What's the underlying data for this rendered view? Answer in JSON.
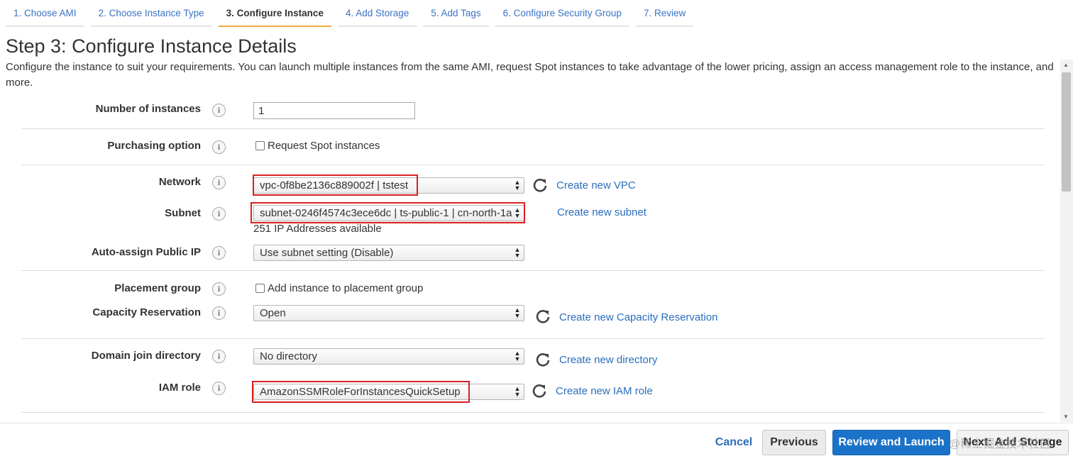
{
  "tabs": [
    {
      "label": "1. Choose AMI"
    },
    {
      "label": "2. Choose Instance Type"
    },
    {
      "label": "3. Configure Instance"
    },
    {
      "label": "4. Add Storage"
    },
    {
      "label": "5. Add Tags"
    },
    {
      "label": "6. Configure Security Group"
    },
    {
      "label": "7. Review"
    }
  ],
  "active_tab_index": 2,
  "page": {
    "title": "Step 3: Configure Instance Details",
    "description": "Configure the instance to suit your requirements. You can launch multiple instances from the same AMI, request Spot instances to take advantage of the lower pricing, assign an access management role to the instance, and more."
  },
  "form": {
    "number_of_instances": {
      "label": "Number of instances",
      "value": "1"
    },
    "purchasing_option": {
      "label": "Purchasing option",
      "checkbox_label": "Request Spot instances",
      "checked": false
    },
    "network": {
      "label": "Network",
      "value": "vpc-0f8be2136c889002f | tstest",
      "link": "Create new VPC"
    },
    "subnet": {
      "label": "Subnet",
      "value": "subnet-0246f4574c3ece6dc | ts-public-1 | cn-north-1a",
      "note": "251 IP Addresses available",
      "link": "Create new subnet"
    },
    "auto_assign_ip": {
      "label": "Auto-assign Public IP",
      "value": "Use subnet setting (Disable)"
    },
    "placement_group": {
      "label": "Placement group",
      "checkbox_label": "Add instance to placement group",
      "checked": false
    },
    "capacity_reservation": {
      "label": "Capacity Reservation",
      "value": "Open",
      "link": "Create new Capacity Reservation"
    },
    "domain_join": {
      "label": "Domain join directory",
      "value": "No directory",
      "link": "Create new directory"
    },
    "iam_role": {
      "label": "IAM role",
      "value": "AmazonSSMRoleForInstancesQuickSetup",
      "link": "Create new IAM role"
    }
  },
  "info_icon_glyph": "i",
  "footer": {
    "cancel": "Cancel",
    "previous": "Previous",
    "review_launch": "Review and Launch",
    "next": "Next: Add Storage"
  },
  "watermark": "@稀土掘金技术社区",
  "colors": {
    "link": "#2a6ebb",
    "primary_button": "#1b72c9",
    "active_tab_underline": "#f0a83b",
    "highlight_box": "#d92020"
  }
}
